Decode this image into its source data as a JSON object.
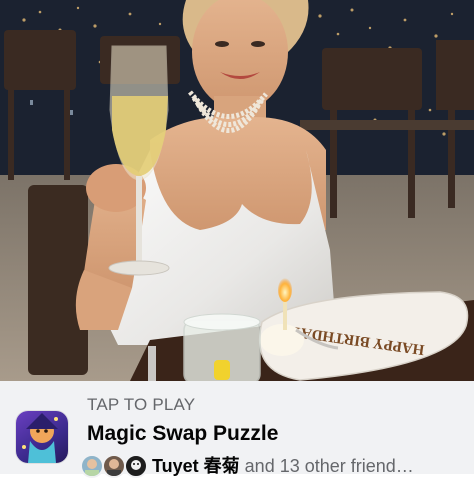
{
  "photo": {
    "cake_plate_text": "HAPPY BIRTHDAY"
  },
  "game_card": {
    "cta_label": "TAP TO PLAY",
    "title": "Magic Swap Puzzle",
    "friend_name": "Tuyet 春菊",
    "friends_suffix": " and 13 other friend…",
    "icon": "game-app-icon"
  },
  "colors": {
    "card_background": "#f1f2f4",
    "secondary_text": "#65676b",
    "primary_text": "#050505"
  }
}
